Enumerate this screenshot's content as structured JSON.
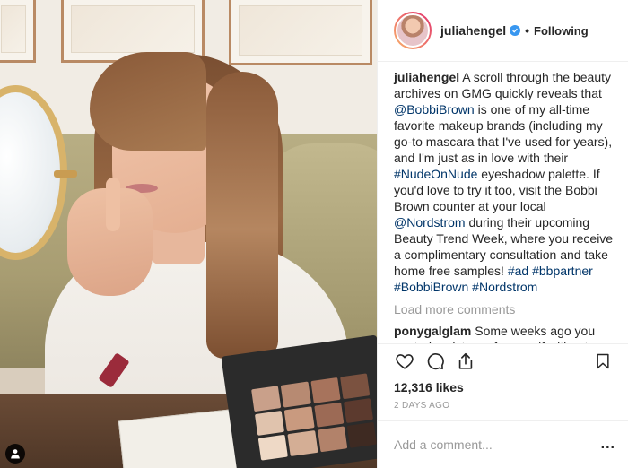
{
  "header": {
    "username": "juliahengel",
    "verified_icon": "verified-check-icon",
    "separator": "•",
    "follow_label": "Following"
  },
  "caption": {
    "username": "juliahengel",
    "t1": " A scroll through the beauty archives on GMG quickly reveals that ",
    "m1": "@BobbiBrown",
    "t2": " is one of my all-time favorite makeup brands (including my go-to mascara that I've used for years), and I'm just as in love with their ",
    "h1": "#NudeOnNude",
    "t3": " eyeshadow palette. If you'd love to try it too, visit the Bobbi Brown counter at your local ",
    "m2": "@Nordstrom",
    "t4": " during their upcoming Beauty Trend Week, where you receive a complimentary consultation and take home free samples! ",
    "h2": "#ad",
    "h3": "#bbpartner",
    "h4": "#BobbiBrown",
    "h5": "#Nordstrom"
  },
  "load_more": "Load more comments",
  "comment": {
    "username": "ponygalglam",
    "text": " Some weeks ago you posted a picture of yourself without make (or only very little). You looked even more beautiful on it. I want to encourage you to be more brave when it comes to a “less is"
  },
  "actions": {
    "like_icon": "heart-icon",
    "comment_icon": "comment-bubble-icon",
    "share_icon": "share-upload-icon",
    "save_icon": "bookmark-icon"
  },
  "likes": "12,316 likes",
  "timestamp": "2 DAYS AGO",
  "add_comment": {
    "placeholder": "Add a comment...",
    "more_label": "..."
  },
  "colors": {
    "link": "#003569",
    "verified": "#3897f0",
    "muted": "#999999",
    "text": "#262626"
  }
}
